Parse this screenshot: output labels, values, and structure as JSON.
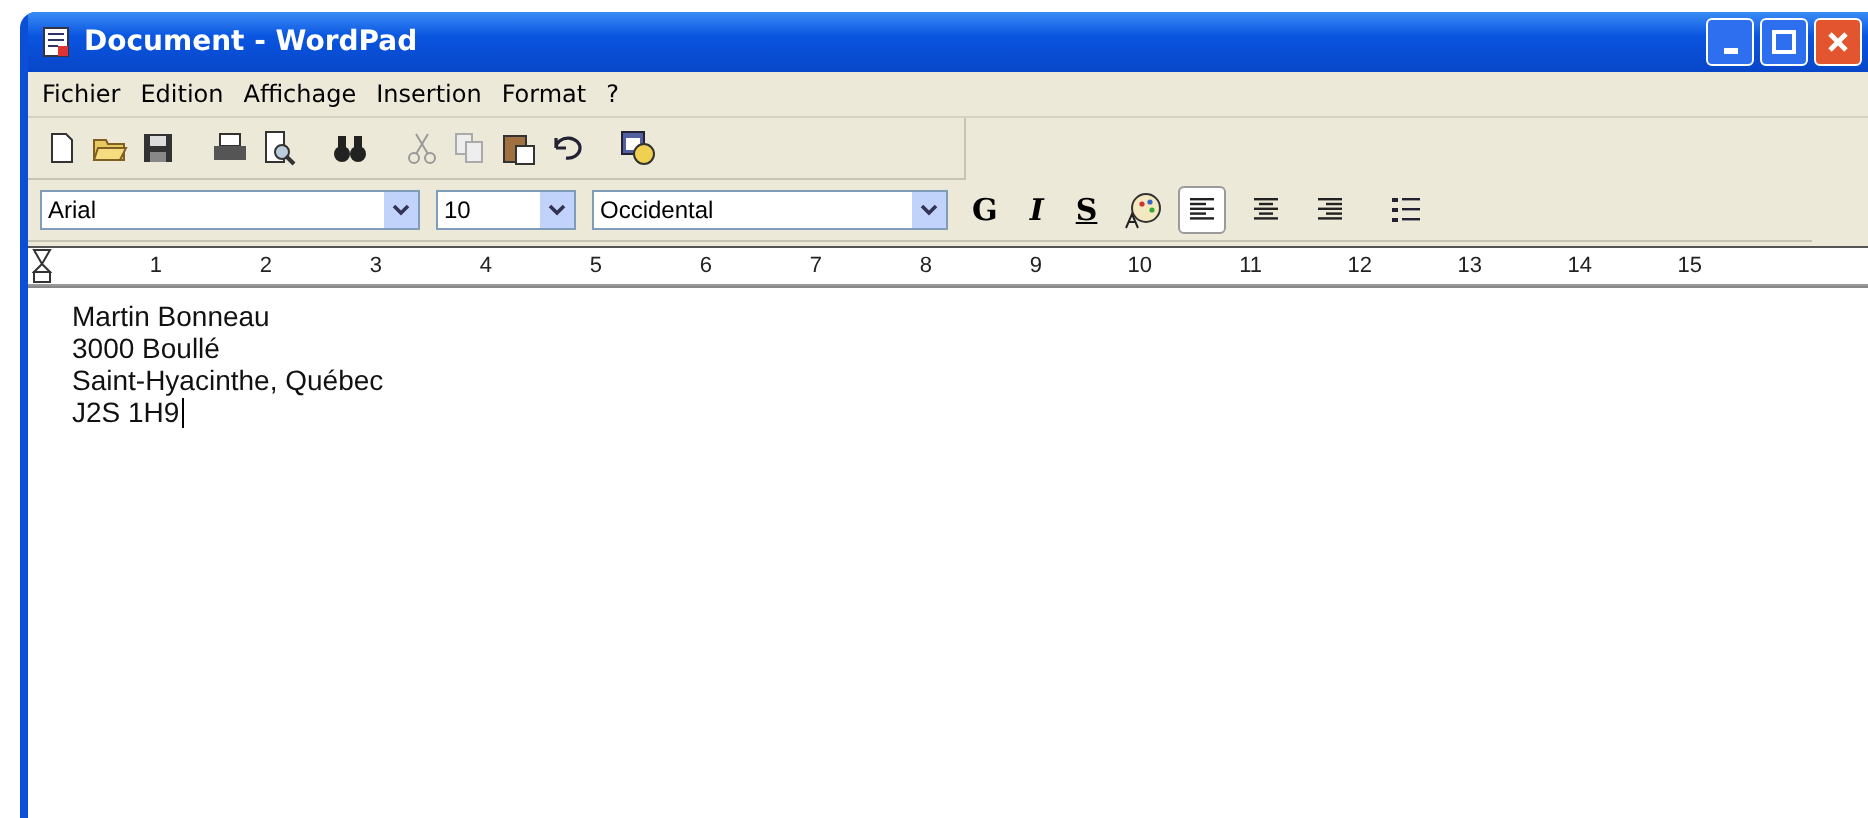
{
  "window": {
    "title": "Document - WordPad"
  },
  "menu": [
    "Fichier",
    "Edition",
    "Affichage",
    "Insertion",
    "Format",
    "?"
  ],
  "toolbar": [
    {
      "kind": "new"
    },
    {
      "kind": "open"
    },
    {
      "kind": "save"
    },
    {
      "kind": "sep"
    },
    {
      "kind": "print"
    },
    {
      "kind": "preview"
    },
    {
      "kind": "sep"
    },
    {
      "kind": "find"
    },
    {
      "kind": "sep"
    },
    {
      "kind": "cut"
    },
    {
      "kind": "copy"
    },
    {
      "kind": "paste"
    },
    {
      "kind": "undo"
    },
    {
      "kind": "sep"
    },
    {
      "kind": "datetime"
    }
  ],
  "format_bar": {
    "font": "Arial",
    "size": "10",
    "script": "Occidental",
    "styles": [
      {
        "label": "G",
        "kind": "bold"
      },
      {
        "label": "I",
        "kind": "italic"
      },
      {
        "label": "S",
        "kind": "underline"
      }
    ],
    "alignment": [
      {
        "kind": "left",
        "selected": true
      },
      {
        "kind": "center",
        "selected": false
      },
      {
        "kind": "right",
        "selected": false
      }
    ]
  },
  "ruler": [
    "1",
    "2",
    "3",
    "4",
    "5",
    "6",
    "7",
    "8",
    "9",
    "10",
    "11",
    "12",
    "13",
    "14",
    "15"
  ],
  "document": {
    "lines": [
      "Martin Bonneau",
      "3000 Boullé",
      "Saint-Hyacinthe, Québec",
      "J2S 1H9"
    ]
  }
}
